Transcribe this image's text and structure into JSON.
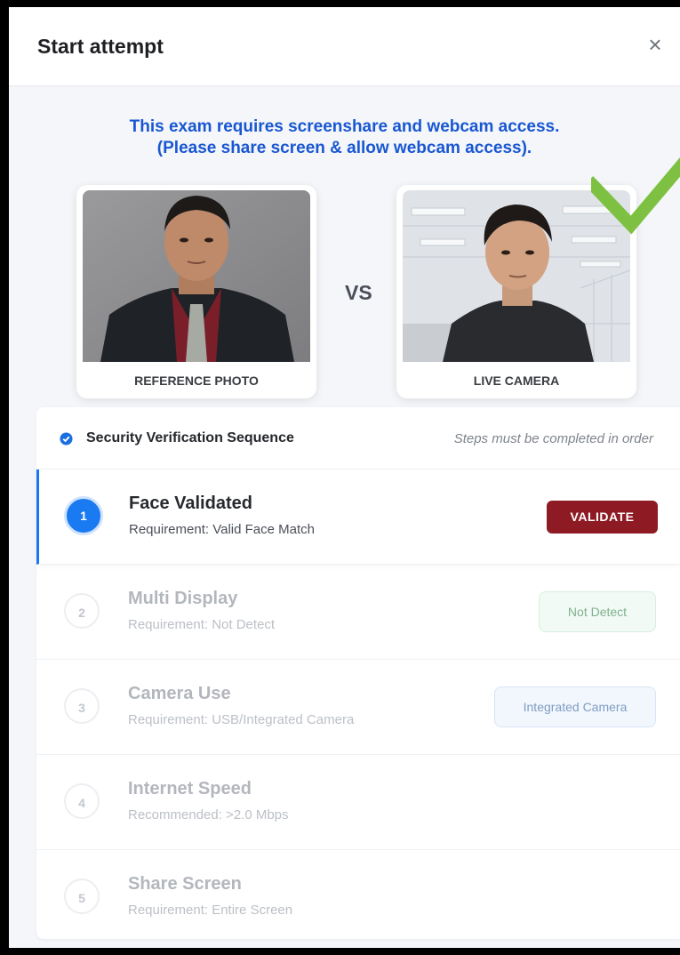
{
  "modal": {
    "title": "Start attempt",
    "close_glyph": "×"
  },
  "notice": {
    "line1": "This exam requires screenshare and webcam access.",
    "line2": "(Please share screen & allow webcam access)."
  },
  "comparison": {
    "reference_caption": "REFERENCE PHOTO",
    "vs_label": "VS",
    "live_caption": "LIVE CAMERA",
    "match_icon": "checkmark-icon"
  },
  "verification": {
    "title": "Security Verification Sequence",
    "note": "Steps must be completed in order",
    "steps": [
      {
        "number": "1",
        "title": "Face Validated",
        "requirement": "Requirement: Valid Face Match",
        "action": "VALIDATE"
      },
      {
        "number": "2",
        "title": "Multi Display",
        "requirement": "Requirement: Not Detect",
        "status": "Not Detect"
      },
      {
        "number": "3",
        "title": "Camera Use",
        "requirement": "Requirement: USB/Integrated Camera",
        "status": "Integrated Camera"
      },
      {
        "number": "4",
        "title": "Internet Speed",
        "requirement": "Recommended: >2.0 Mbps"
      },
      {
        "number": "5",
        "title": "Share Screen",
        "requirement": "Requirement: Entire Screen"
      }
    ]
  },
  "colors": {
    "accent_blue": "#1a7af1",
    "validate_red": "#8e1b24",
    "check_green": "#7ec142"
  }
}
